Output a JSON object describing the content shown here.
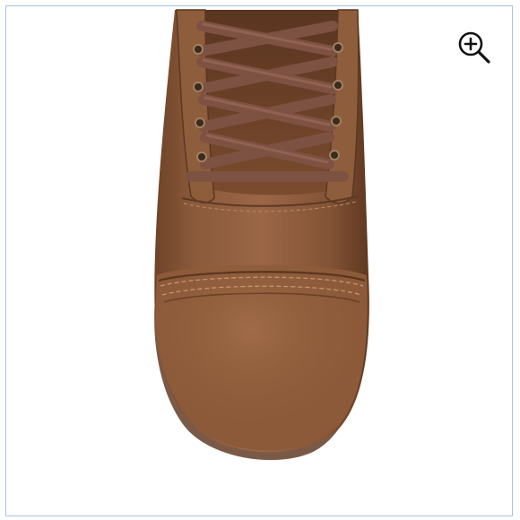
{
  "viewer": {
    "zoom_icon": "zoom-in-icon",
    "image_subject": "boot-toe-closeup",
    "colors": {
      "frame_border": "#a9c4e6",
      "leather": "#8b5a3a",
      "laces": "#7a4e3a",
      "icon": "#111111"
    }
  }
}
